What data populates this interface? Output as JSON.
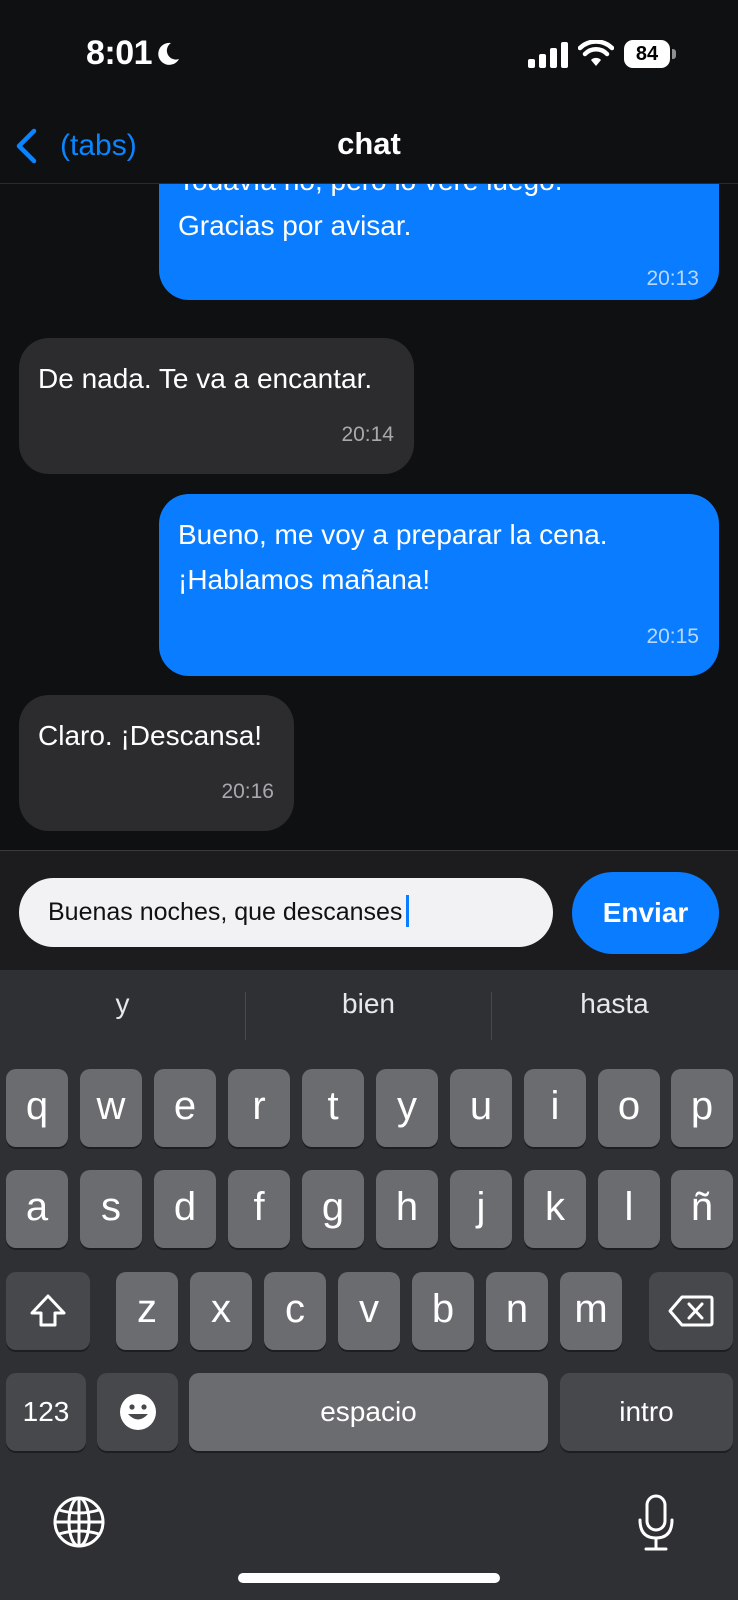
{
  "status_bar": {
    "time": "8:01",
    "battery": "84"
  },
  "nav": {
    "back_label": "(tabs)",
    "title": "chat"
  },
  "messages": [
    {
      "side": "sent",
      "text_line1": "Todavía no, pero lo veré luego.",
      "text_line2": "Gracias por avisar.",
      "time": "20:13"
    },
    {
      "side": "received",
      "text": "De nada. Te va a encantar.",
      "time": "20:14"
    },
    {
      "side": "sent",
      "text_line1": "Bueno, me voy a preparar la cena.",
      "text_line2": "¡Hablamos mañana!",
      "time": "20:15"
    },
    {
      "side": "received",
      "text": "Claro. ¡Descansa!",
      "time": "20:16"
    }
  ],
  "composer": {
    "value": "Buenas noches, que descanses",
    "send_label": "Enviar"
  },
  "keyboard": {
    "suggestions": [
      "y",
      "bien",
      "hasta"
    ],
    "row1": [
      "q",
      "w",
      "e",
      "r",
      "t",
      "y",
      "u",
      "i",
      "o",
      "p"
    ],
    "row2": [
      "a",
      "s",
      "d",
      "f",
      "g",
      "h",
      "j",
      "k",
      "l",
      "ñ"
    ],
    "row3": [
      "z",
      "x",
      "c",
      "v",
      "b",
      "n",
      "m"
    ],
    "numbers_label": "123",
    "space_label": "espacio",
    "return_label": "intro",
    "icons": [
      "shift-icon",
      "backspace-icon",
      "emoji-icon",
      "globe-icon",
      "microphone-icon"
    ]
  },
  "colors": {
    "accent": "#0a7cff",
    "received_bubble": "#2c2c2e",
    "background": "#0f1012"
  }
}
